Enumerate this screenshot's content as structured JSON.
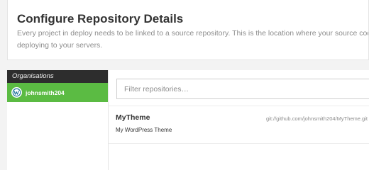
{
  "header": {
    "title": "Configure Repository Details",
    "description_line1": "Every project in deploy needs to be linked to a source repository. This is the location where your source code will be taken from",
    "description_line2": "deploying to your servers."
  },
  "sidebar": {
    "heading": "Organisations",
    "items": [
      {
        "label": "johnsmith204",
        "icon": "wordpress-icon",
        "active": true
      }
    ]
  },
  "main": {
    "filter": {
      "placeholder": "Filter repositories…",
      "value": ""
    },
    "repositories": [
      {
        "name": "MyTheme",
        "url": "git://github.com/johnsmith204/MyTheme.git",
        "description": "My WordPress Theme"
      }
    ]
  },
  "colors": {
    "accent": "#5bbb43",
    "sidebar_header": "#2d2d2d",
    "background": "#f3f3f3"
  }
}
